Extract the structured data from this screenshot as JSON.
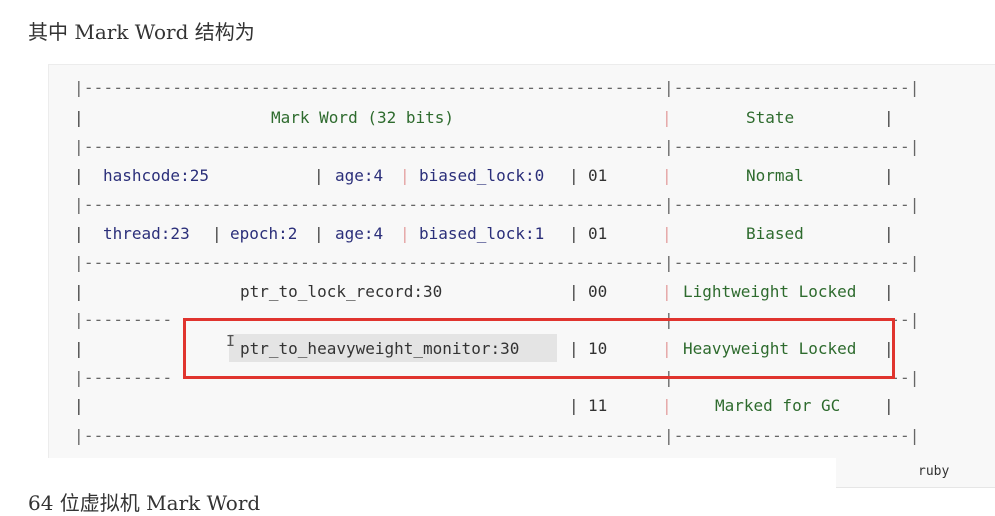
{
  "page": {
    "heading": "其中 Mark Word 结构为",
    "next_heading": "64 位虚拟机 Mark Word",
    "code_lang": "ruby"
  },
  "table": {
    "separator": "|-----------------------------------------------------------|------------------------|",
    "separator_gap": "|---------                                                  |------------------------|",
    "header": {
      "mark_word": "Mark Word (32 bits)",
      "state": "State"
    },
    "rows": [
      {
        "hashcode": "hashcode:25",
        "age": "age:4",
        "biased_lock": "biased_lock:0",
        "bits": "01",
        "state": "Normal"
      },
      {
        "thread": "thread:23",
        "epoch": "epoch:2",
        "age": "age:4",
        "biased_lock": "biased_lock:1",
        "bits": "01",
        "state": "Biased"
      },
      {
        "ptr": "ptr_to_lock_record:30",
        "bits": "00",
        "state": "Lightweight Locked"
      },
      {
        "ptr": "ptr_to_heavyweight_monitor:30",
        "bits": "10",
        "state": "Heavyweight Locked"
      },
      {
        "bits": "11",
        "state": "Marked for GC"
      }
    ]
  },
  "colors": {
    "highlight_border": "#e0342e",
    "field_text": "#2b2f7a",
    "state_text": "#2e6b2e"
  },
  "icons": {
    "cursor": "text-cursor-icon"
  }
}
